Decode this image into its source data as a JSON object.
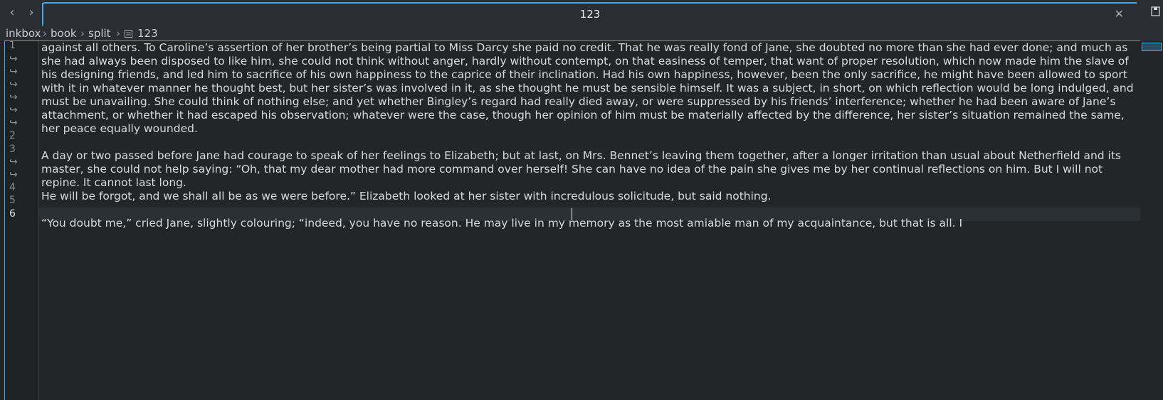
{
  "tab": {
    "title": "123"
  },
  "breadcrumb": {
    "items": [
      "inkbox",
      "book",
      "split",
      "123"
    ]
  },
  "editor": {
    "lines": [
      "against all others. To Caroline’s assertion of her brother’s being partial to Miss Darcy she paid no credit. That he was really fond of Jane, she doubted no more than she had ever done; and much as she had always been disposed to like him, she could not think without anger, hardly without contempt, on that easiness of temper, that want of proper resolution, which now made him the slave of his designing friends, and led him to sacrifice of his own happiness to the caprice of their inclination. Had his own happiness, however, been the only sacrifice, he might have been allowed to sport with it in whatever manner he thought best, but her sister’s was involved in it, as she thought he must be sensible himself. It was a subject, in short, on which reflection would be long indulged, and must be unavailing. She could think of nothing else; and yet whether Bingley’s regard had really died away, or were suppressed by his friends’ interference; whether he had been aware of Jane’s attachment, or whether it had escaped his observation; whatever were the case, though her opinion of him must be materially affected by the difference, her sister’s situation remained the same, her peace equally wounded.",
      "",
      "A day or two passed before Jane had courage to speak of her feelings to Elizabeth; but at last, on Mrs. Bennet’s leaving them together, after a longer irritation than usual about Netherfield and its master, she could not help saying: “Oh, that my dear mother had more command over herself! She can have no idea of the pain she gives me by her continual reflections on him. But I will not repine. It cannot last long.",
      "He will be forgot, and we shall all be as we were before.” Elizabeth looked at her sister with incredulous solicitude, but said nothing.",
      "",
      "“You doubt me,” cried Jane, slightly colouring; “indeed, you have no reason. He may live in my memory as the most amiable man of my acquaintance, but that is all. I"
    ],
    "line_numbers": [
      "1",
      "2",
      "3",
      "4",
      "5",
      "6"
    ]
  }
}
